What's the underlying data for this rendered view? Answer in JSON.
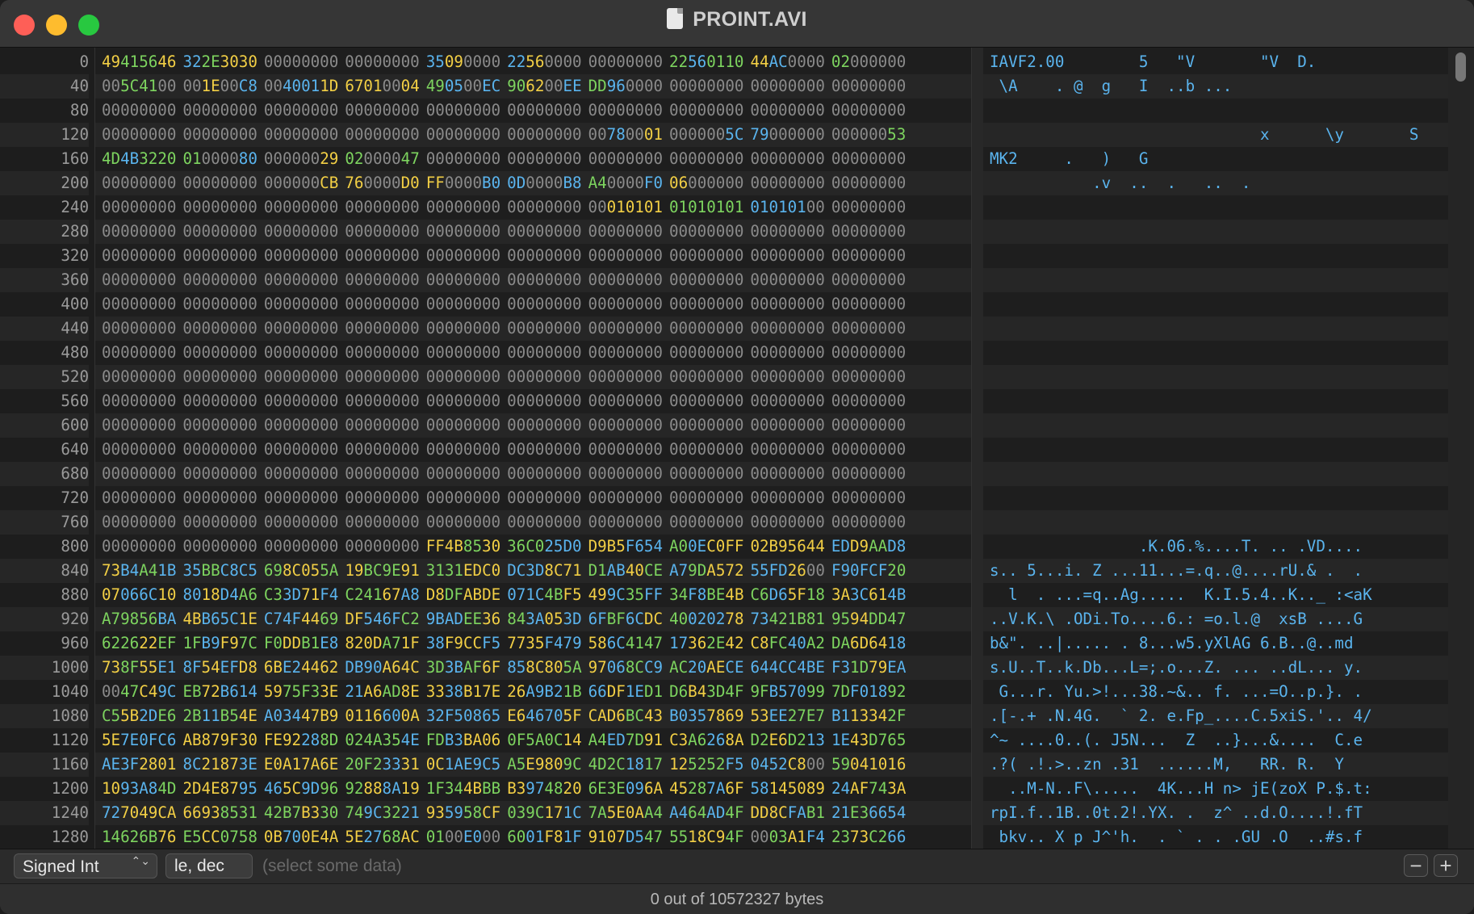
{
  "window": {
    "title": "PROINT.AVI"
  },
  "icons": {
    "close": "close-icon",
    "minimize": "minimize-icon",
    "zoom": "zoom-icon",
    "file": "document-icon"
  },
  "colors": {
    "gray": "#8a8a8a",
    "blue": "#5ab4ee",
    "yellow": "#f2cf45",
    "green": "#7dd45f"
  },
  "rows": [
    {
      "offset": "0",
      "words": [
        "49415646",
        "322E3030",
        "00000000",
        "00000000",
        "35090000",
        "22560000",
        "00000000",
        "22560110",
        "44AC0000",
        "02000000"
      ],
      "ascii": "IAVF2.00        5   \"V       \"V  D."
    },
    {
      "offset": "40",
      "words": [
        "005C4100",
        "001E00C8",
        "0040011D",
        "67010004",
        "490500EC",
        "906200EE",
        "DD960000",
        "00000000",
        "00000000",
        "00000000"
      ],
      "ascii": " \\A    . @  g   I  ..b ..."
    },
    {
      "offset": "80",
      "words": [
        "00000000",
        "00000000",
        "00000000",
        "00000000",
        "00000000",
        "00000000",
        "00000000",
        "00000000",
        "00000000",
        "00000000"
      ],
      "ascii": ""
    },
    {
      "offset": "120",
      "words": [
        "00000000",
        "00000000",
        "00000000",
        "00000000",
        "00000000",
        "00000000",
        "00780001",
        "0000005C",
        "79000000",
        "00000053"
      ],
      "ascii": "                             x      \\y       S"
    },
    {
      "offset": "160",
      "words": [
        "4D4B3220",
        "01000080",
        "00000029",
        "02000047",
        "00000000",
        "00000000",
        "00000000",
        "00000000",
        "00000000",
        "00000000"
      ],
      "ascii": "MK2     .   )   G"
    },
    {
      "offset": "200",
      "words": [
        "00000000",
        "00000000",
        "000000CB",
        "760000D0",
        "FF0000B0",
        "0D0000B8",
        "A40000F0",
        "06000000",
        "00000000",
        "00000000"
      ],
      "ascii": "           .v  ..  .   ..  ."
    },
    {
      "offset": "240",
      "words": [
        "00000000",
        "00000000",
        "00000000",
        "00000000",
        "00000000",
        "00000000",
        "00010101",
        "01010101",
        "01010100",
        "00000000"
      ],
      "ascii": ""
    },
    {
      "offset": "280",
      "words": [
        "00000000",
        "00000000",
        "00000000",
        "00000000",
        "00000000",
        "00000000",
        "00000000",
        "00000000",
        "00000000",
        "00000000"
      ],
      "ascii": ""
    },
    {
      "offset": "320",
      "words": [
        "00000000",
        "00000000",
        "00000000",
        "00000000",
        "00000000",
        "00000000",
        "00000000",
        "00000000",
        "00000000",
        "00000000"
      ],
      "ascii": ""
    },
    {
      "offset": "360",
      "words": [
        "00000000",
        "00000000",
        "00000000",
        "00000000",
        "00000000",
        "00000000",
        "00000000",
        "00000000",
        "00000000",
        "00000000"
      ],
      "ascii": ""
    },
    {
      "offset": "400",
      "words": [
        "00000000",
        "00000000",
        "00000000",
        "00000000",
        "00000000",
        "00000000",
        "00000000",
        "00000000",
        "00000000",
        "00000000"
      ],
      "ascii": ""
    },
    {
      "offset": "440",
      "words": [
        "00000000",
        "00000000",
        "00000000",
        "00000000",
        "00000000",
        "00000000",
        "00000000",
        "00000000",
        "00000000",
        "00000000"
      ],
      "ascii": ""
    },
    {
      "offset": "480",
      "words": [
        "00000000",
        "00000000",
        "00000000",
        "00000000",
        "00000000",
        "00000000",
        "00000000",
        "00000000",
        "00000000",
        "00000000"
      ],
      "ascii": ""
    },
    {
      "offset": "520",
      "words": [
        "00000000",
        "00000000",
        "00000000",
        "00000000",
        "00000000",
        "00000000",
        "00000000",
        "00000000",
        "00000000",
        "00000000"
      ],
      "ascii": ""
    },
    {
      "offset": "560",
      "words": [
        "00000000",
        "00000000",
        "00000000",
        "00000000",
        "00000000",
        "00000000",
        "00000000",
        "00000000",
        "00000000",
        "00000000"
      ],
      "ascii": ""
    },
    {
      "offset": "600",
      "words": [
        "00000000",
        "00000000",
        "00000000",
        "00000000",
        "00000000",
        "00000000",
        "00000000",
        "00000000",
        "00000000",
        "00000000"
      ],
      "ascii": ""
    },
    {
      "offset": "640",
      "words": [
        "00000000",
        "00000000",
        "00000000",
        "00000000",
        "00000000",
        "00000000",
        "00000000",
        "00000000",
        "00000000",
        "00000000"
      ],
      "ascii": ""
    },
    {
      "offset": "680",
      "words": [
        "00000000",
        "00000000",
        "00000000",
        "00000000",
        "00000000",
        "00000000",
        "00000000",
        "00000000",
        "00000000",
        "00000000"
      ],
      "ascii": ""
    },
    {
      "offset": "720",
      "words": [
        "00000000",
        "00000000",
        "00000000",
        "00000000",
        "00000000",
        "00000000",
        "00000000",
        "00000000",
        "00000000",
        "00000000"
      ],
      "ascii": ""
    },
    {
      "offset": "760",
      "words": [
        "00000000",
        "00000000",
        "00000000",
        "00000000",
        "00000000",
        "00000000",
        "00000000",
        "00000000",
        "00000000",
        "00000000"
      ],
      "ascii": ""
    },
    {
      "offset": "800",
      "words": [
        "00000000",
        "00000000",
        "00000000",
        "00000000",
        "FF4B8530",
        "36C025D0",
        "D9B5F654",
        "A00EC0FF",
        "02B95644",
        "EDD9AAD8"
      ],
      "ascii": "                .K.06.%....T. .. .VD...."
    },
    {
      "offset": "840",
      "words": [
        "73B4A41B",
        "35BBC8C5",
        "698C055A",
        "19BC9E91",
        "3131EDC0",
        "DC3D8C71",
        "D1AB40CE",
        "A79DA572",
        "55FD2600",
        "F90FCF20"
      ],
      "ascii": "s.. 5...i. Z ...11...=.q..@....rU.& .  ."
    },
    {
      "offset": "880",
      "words": [
        "07066C10",
        "8018D4A6",
        "C33D71F4",
        "C24167A8",
        "D8DFABDE",
        "071C4BF5",
        "499C35FF",
        "34F8BE4B",
        "C6D65F18",
        "3A3C614B"
      ],
      "ascii": "  l  . ...=q..Ag.....  K.I.5.4..K.._ :<aK"
    },
    {
      "offset": "920",
      "words": [
        "A79856BA",
        "4BB65C1E",
        "C74F4469",
        "DF546FC2",
        "9BADEE36",
        "843A053D",
        "6FBF6CDC",
        "40020278",
        "73421B81",
        "9594DD47"
      ],
      "ascii": "..V.K.\\ .ODi.To....6.: =o.l.@  xsB ....G"
    },
    {
      "offset": "960",
      "words": [
        "622622EF",
        "1FB9F97C",
        "F0DDB1E8",
        "820DA71F",
        "38F9CCF5",
        "7735F479",
        "586C4147",
        "17362E42",
        "C8FC40A2",
        "DA6D6418"
      ],
      "ascii": "b&\". ..|..... . 8...w5.yXlAG 6.B..@..md"
    },
    {
      "offset": "1000",
      "words": [
        "738F55E1",
        "8F54EFD8",
        "6BE24462",
        "DB90A64C",
        "3D3BAF6F",
        "858C805A",
        "97068CC9",
        "AC20AECE",
        "644CC4BE",
        "F31D79EA"
      ],
      "ascii": "s.U..T..k.Db...L=;.o...Z. ... ..dL... y."
    },
    {
      "offset": "1040",
      "words": [
        "0047C49C",
        "EB72B614",
        "5975F33E",
        "21A6AD8E",
        "3338B17E",
        "26A9B21B",
        "66DF1ED1",
        "D6B43D4F",
        "9FB57099",
        "7DF01892"
      ],
      "ascii": " G...r. Yu.>!...38.~&.. f. ...=O..p.}. ."
    },
    {
      "offset": "1080",
      "words": [
        "C55B2DE6",
        "2B11B54E",
        "A03447B9",
        "0116600A",
        "32F50865",
        "E646705F",
        "CAD6BC43",
        "B0357869",
        "53EE27E7",
        "B113342F"
      ],
      "ascii": ".[-.+ .N.4G.  ` 2. e.Fp_....C.5xiS.'.. 4/"
    },
    {
      "offset": "1120",
      "words": [
        "5E7E0FC6",
        "AB879F30",
        "FE92288D",
        "024A354E",
        "FDB3BA06",
        "0F5A0C14",
        "A4ED7D91",
        "C3A6268A",
        "D2E6D213",
        "1E43D765"
      ],
      "ascii": "^~ ....0..(. J5N...  Z  ..}...&....  C.e"
    },
    {
      "offset": "1160",
      "words": [
        "AE3F2801",
        "8C21873E",
        "E0A17A6E",
        "20F23331",
        "0C1AE9C5",
        "A5E9809C",
        "4D2C1817",
        "125252F5",
        "0452C800",
        "59041016"
      ],
      "ascii": ".?( .!.>..zn .31  ......M,   RR. R.  Y"
    },
    {
      "offset": "1200",
      "words": [
        "1093A84D",
        "2D4E8795",
        "465C9D96",
        "92888A19",
        "1F344BBB",
        "B3974820",
        "6E3E096A",
        "45287A6F",
        "58145089",
        "24AF743A"
      ],
      "ascii": "  ..M-N..F\\.....  4K...H n> jE(zoX P.$.t:"
    },
    {
      "offset": "1240",
      "words": [
        "727049CA",
        "66938531",
        "42B7B330",
        "749C3221",
        "935958CF",
        "039C171C",
        "7A5E0AA4",
        "A464AD4F",
        "DD8CFAB1",
        "21E36654"
      ],
      "ascii": "rpI.f..1B..0t.2!.YX. .  z^ ..d.O....!.fT"
    },
    {
      "offset": "1280",
      "words": [
        "14626B76",
        "E5CC0758",
        "0B700E4A",
        "5E2768AC",
        "0100E000",
        "6001F81F",
        "9107D547",
        "5518C94F",
        "0003A1F4",
        "2373C266"
      ],
      "ascii": " bkv.. X p J^'h.  . ` . . .GU .O  ..#s.f"
    }
  ],
  "bottom": {
    "type_select": "Signed Int",
    "type_arrows": "⌃⌄",
    "format_field": "le, dec",
    "selection_hint": "(select some data)",
    "minus_label": "−",
    "plus_label": "+"
  },
  "status": {
    "text": "0 out of 10572327 bytes"
  }
}
